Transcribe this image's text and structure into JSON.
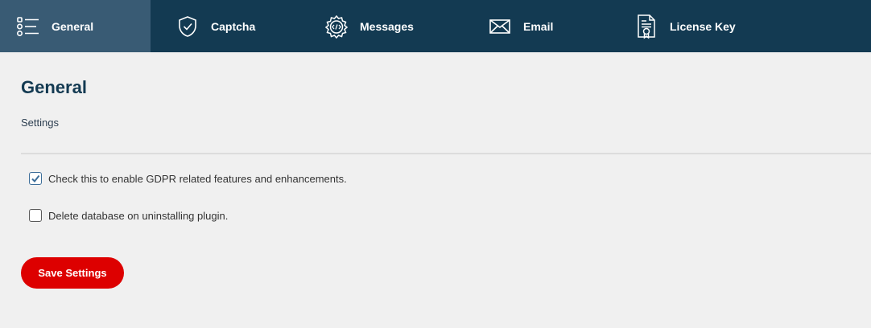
{
  "tabs": [
    {
      "label": "General",
      "icon": "list-icon",
      "active": true
    },
    {
      "label": "Captcha",
      "icon": "shield-check-icon",
      "active": false
    },
    {
      "label": "Messages",
      "icon": "code-gear-icon",
      "active": false
    },
    {
      "label": "Email",
      "icon": "envelope-icon",
      "active": false
    },
    {
      "label": "License Key",
      "icon": "certificate-icon",
      "active": false
    }
  ],
  "page": {
    "title": "General",
    "section_label": "Settings"
  },
  "options": [
    {
      "label": "Check this to enable GDPR related features and enhancements.",
      "checked": true
    },
    {
      "label": "Delete database on uninstalling plugin.",
      "checked": false
    }
  ],
  "save_button_label": "Save Settings",
  "colors": {
    "tabbar_bg": "#133a52",
    "tab_active_bg": "#395b74",
    "page_bg": "#f0f0f0",
    "save_button_bg": "#dd0000",
    "checkbox_check": "#3d6e9a"
  }
}
